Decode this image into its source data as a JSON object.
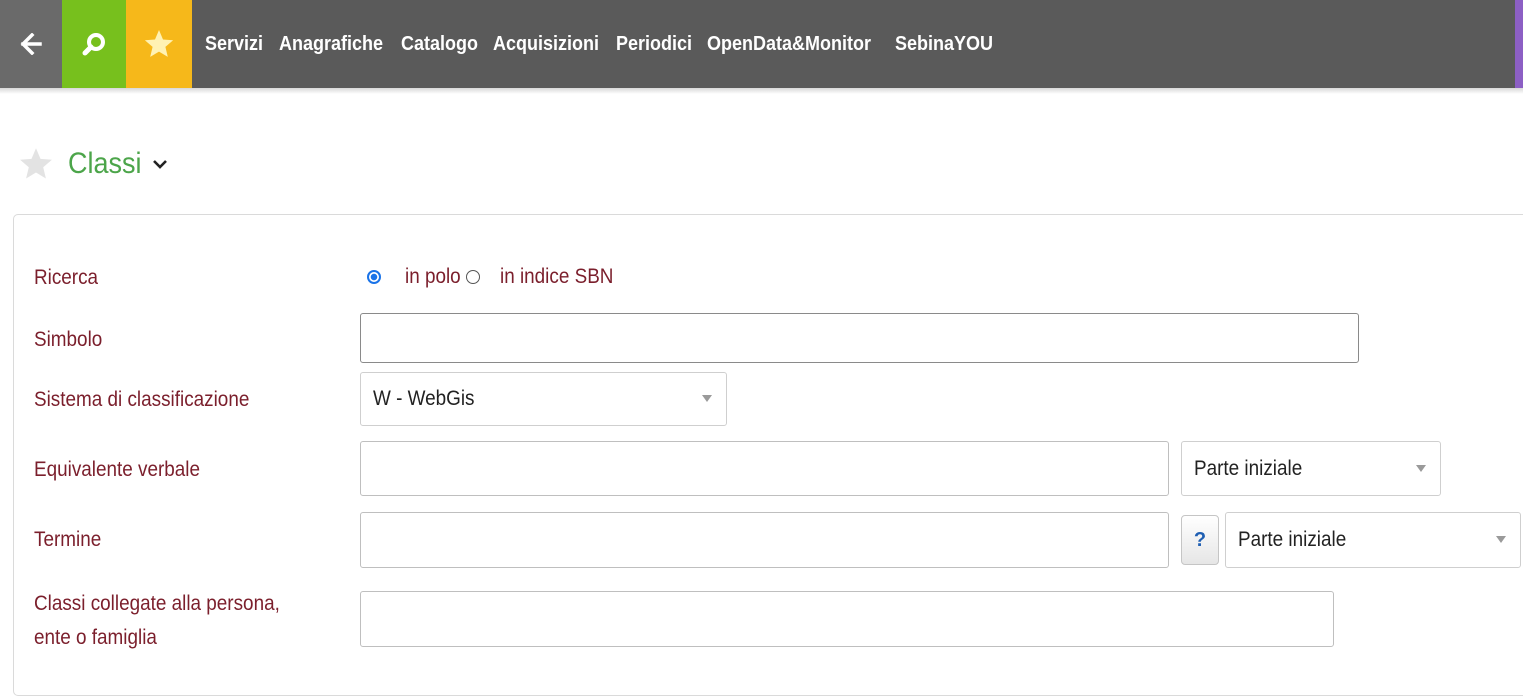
{
  "nav": {
    "back_icon": "arrow-left-icon",
    "search_icon": "search-icon",
    "favorites_icon": "star-icon",
    "items": [
      {
        "label": "Servizi"
      },
      {
        "label": "Anagrafiche"
      },
      {
        "label": "Catalogo"
      },
      {
        "label": "Acquisizioni"
      },
      {
        "label": "Periodici"
      },
      {
        "label": "OpenData&Monitor"
      },
      {
        "label": "SebinaYOU"
      }
    ]
  },
  "page": {
    "title": "Classi"
  },
  "form": {
    "ricerca": {
      "label": "Ricerca",
      "options": [
        {
          "label": "in polo",
          "selected": true
        },
        {
          "label": "in indice SBN",
          "selected": false
        }
      ]
    },
    "simbolo": {
      "label": "Simbolo",
      "value": ""
    },
    "sistema": {
      "label": "Sistema di classificazione",
      "selected": "W - WebGis"
    },
    "equivalente": {
      "label": "Equivalente verbale",
      "value": "",
      "mode": "Parte iniziale"
    },
    "termine": {
      "label": "Termine",
      "value": "",
      "help": "?",
      "mode": "Parte iniziale"
    },
    "collegate": {
      "label_line1": "Classi collegate alla persona,",
      "label_line2": "ente o famiglia",
      "value": ""
    }
  },
  "colors": {
    "topbar": "#5a5a5a",
    "search_green": "#77c01d",
    "favorites_yellow": "#f6b81a",
    "title_green": "#4ca54a",
    "label_maroon": "#7b1f2c",
    "radio_blue": "#1a73e8"
  }
}
